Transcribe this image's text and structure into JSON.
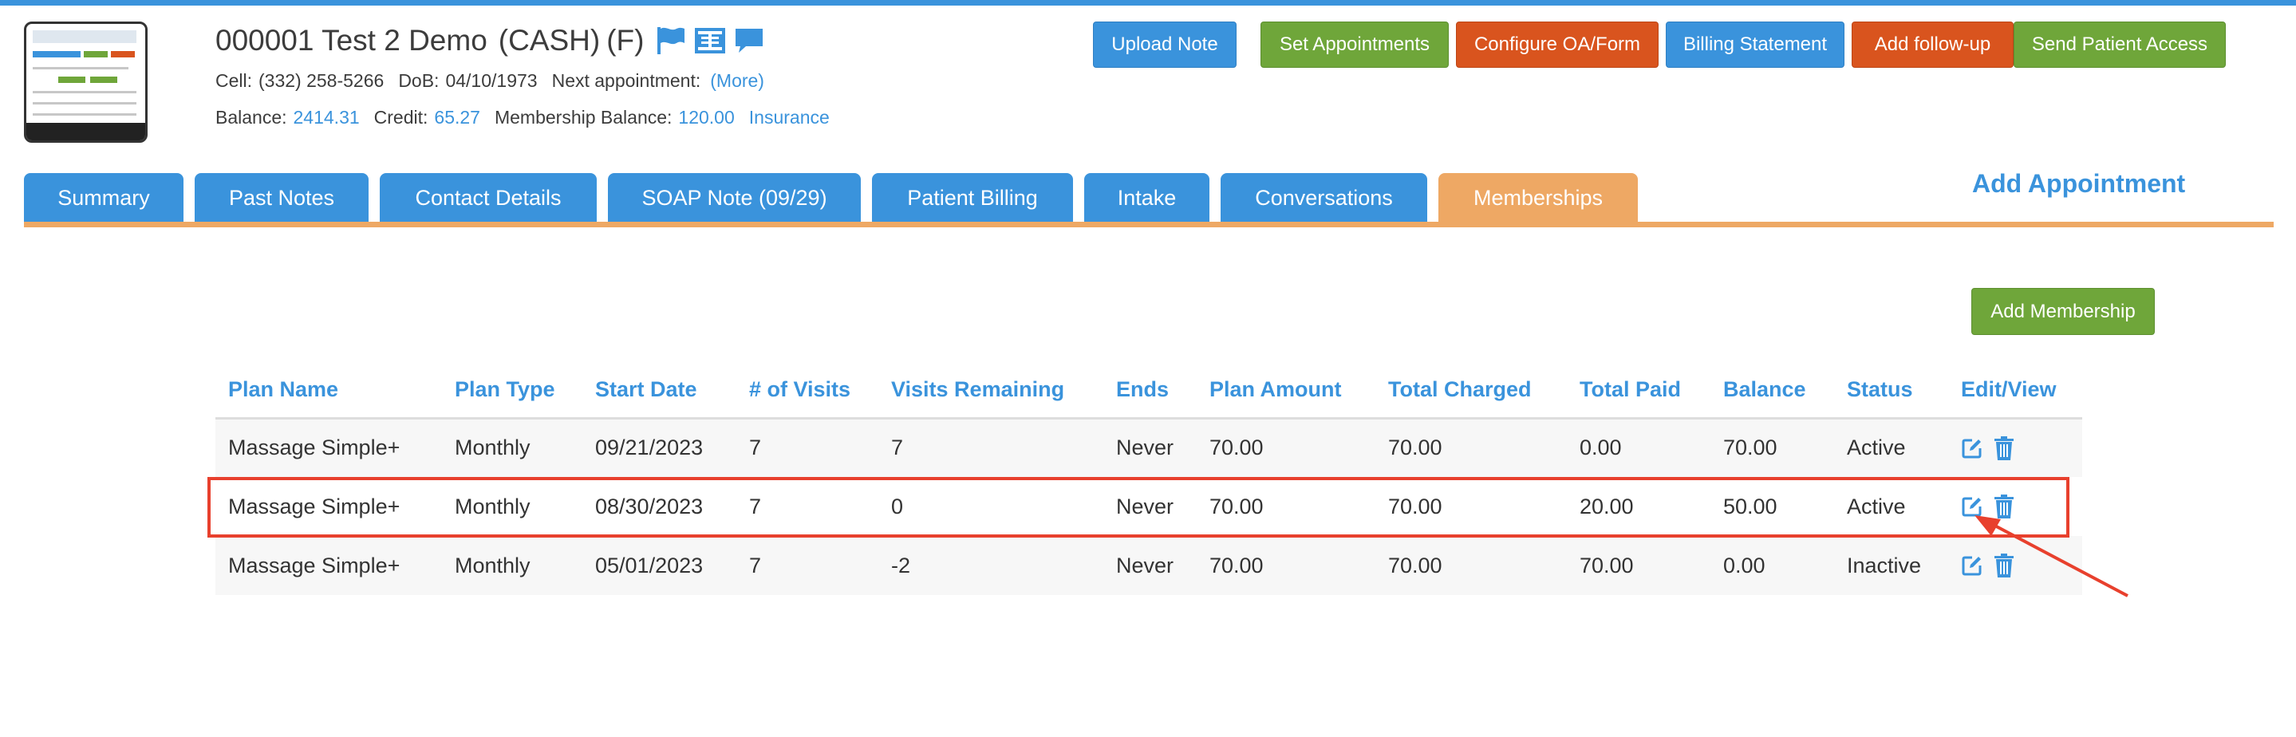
{
  "patient": {
    "name": "000001 Test 2 Demo",
    "payment_type": "(CASH)",
    "gender": "(F)",
    "cell_label": "Cell:",
    "cell": "(332) 258-5266",
    "dob_label": "DoB:",
    "dob": "04/10/1973",
    "next_appt_label": "Next appointment:",
    "next_appt_link": "(More)",
    "balance_label": "Balance:",
    "balance": "2414.31",
    "credit_label": "Credit:",
    "credit": "65.27",
    "membership_balance_label": "Membership Balance:",
    "membership_balance": "120.00",
    "insurance_link": "Insurance"
  },
  "actions": {
    "upload_note": "Upload Note",
    "set_appointments": "Set Appointments",
    "configure_oa_form": "Configure OA/Form",
    "billing_statement": "Billing Statement",
    "add_follow_up": "Add follow-up",
    "send_patient_access": "Send Patient Access"
  },
  "tabs": [
    {
      "label": "Summary"
    },
    {
      "label": "Past Notes"
    },
    {
      "label": "Contact Details"
    },
    {
      "label": "SOAP Note (09/29)"
    },
    {
      "label": "Patient Billing"
    },
    {
      "label": "Intake"
    },
    {
      "label": "Conversations"
    },
    {
      "label": "Memberships",
      "active": true
    }
  ],
  "add_appointment": "Add Appointment",
  "add_membership": "Add Membership",
  "table": {
    "columns": [
      "Plan Name",
      "Plan Type",
      "Start Date",
      "# of Visits",
      "Visits Remaining",
      "Ends",
      "Plan Amount",
      "Total Charged",
      "Total Paid",
      "Balance",
      "Status",
      "Edit/View"
    ],
    "rows": [
      [
        "Massage Simple+",
        "Monthly",
        "09/21/2023",
        "7",
        "7",
        "Never",
        "70.00",
        "70.00",
        "0.00",
        "70.00",
        "Active"
      ],
      [
        "Massage Simple+",
        "Monthly",
        "08/30/2023",
        "7",
        "0",
        "Never",
        "70.00",
        "70.00",
        "20.00",
        "50.00",
        "Active"
      ],
      [
        "Massage Simple+",
        "Monthly",
        "05/01/2023",
        "7",
        "-2",
        "Never",
        "70.00",
        "70.00",
        "70.00",
        "0.00",
        "Inactive"
      ]
    ]
  },
  "icons": {
    "flag": "flag-icon",
    "document": "document-icon",
    "chat": "chat-icon",
    "edit": "edit-icon",
    "delete": "trash-icon"
  },
  "colors": {
    "primary": "#3a93dc",
    "green": "#6fa63a",
    "orange": "#d9541e",
    "active_tab": "#eea864",
    "annotation": "#e8402d"
  }
}
